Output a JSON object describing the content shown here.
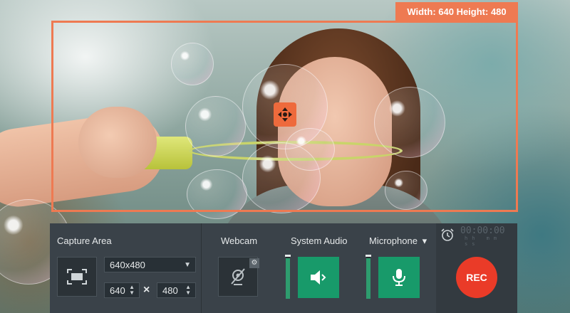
{
  "frame": {
    "dimensions_label": "Width: 640  Height: 480",
    "accent_color": "#ee7a52"
  },
  "panel": {
    "capture_area": {
      "label": "Capture Area",
      "preset_value": "640x480",
      "width_value": "640",
      "height_value": "480",
      "separator": "×"
    },
    "webcam": {
      "label": "Webcam",
      "state": "off"
    },
    "system_audio": {
      "label": "System Audio",
      "level_percent": 95
    },
    "microphone": {
      "label": "Microphone",
      "dropdown_arrow": "▾",
      "level_percent": 95
    },
    "timer": {
      "digits": "00:00:00",
      "units": "hh mm ss"
    },
    "rec": {
      "label": "REC",
      "color": "#ea3b28"
    },
    "icons": {
      "area": "capture-area-icon",
      "webcam": "webcam-off-icon",
      "gear": "gear-icon",
      "speaker": "speaker-icon",
      "mic": "microphone-icon",
      "alarm": "alarm-clock-icon",
      "move": "move-arrows-icon"
    }
  }
}
